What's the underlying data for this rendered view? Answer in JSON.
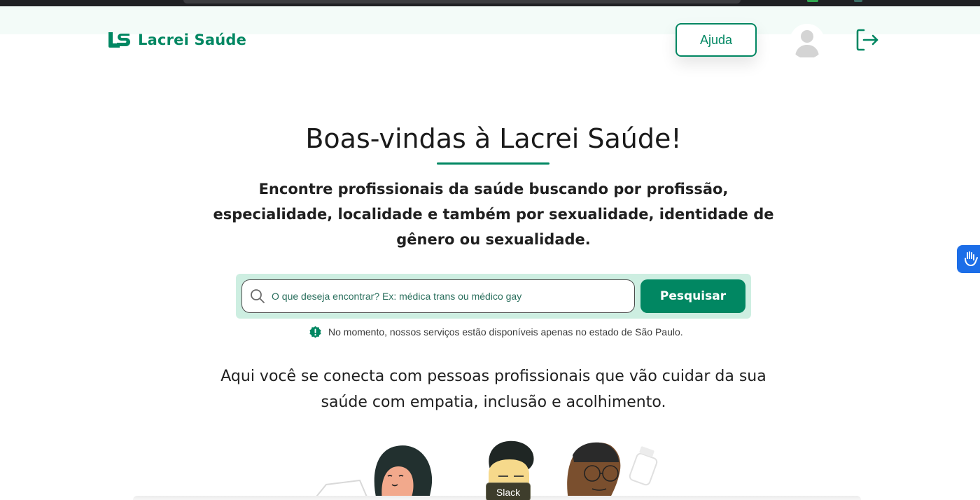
{
  "brand": {
    "name": "Lacrei Saúde",
    "color": "#018762"
  },
  "header": {
    "help_label": "Ajuda",
    "avatar_icon": "user-avatar-icon",
    "logout_icon": "logout-icon"
  },
  "hero": {
    "title": "Boas-vindas à Lacrei Saúde!",
    "lead": "Encontre profissionais da saúde buscando por profissão, especialidade, localidade e também por sexualidade, identidade de gênero ou sexualidade."
  },
  "search": {
    "placeholder": "O que deseja encontrar? Ex: médica trans ou médico gay",
    "button_label": "Pesquisar",
    "icon": "search-icon"
  },
  "notice": {
    "text": "No momento, nossos serviços estão disponíveis apenas no estado de São Paulo.",
    "icon": "alert-icon"
  },
  "tagline": "Aqui você se conecta com pessoas profissionais que vão cuidar da sua saúde com empatia, inclusão e acolhimento.",
  "tooltip": {
    "text": "Slack"
  },
  "accessibility": {
    "icon": "sign-language-icon",
    "color": "#1c6ee8"
  }
}
